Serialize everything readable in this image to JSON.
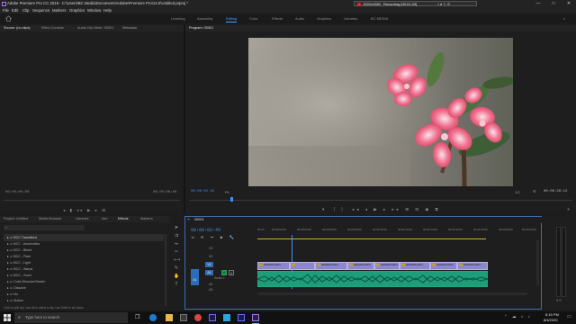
{
  "window": {
    "title": "Adobe Premiere Pro CC 2019 - C:\\Users\\BC Media\\Documents\\Adobe\\Premiere Pro\\13.0\\Untitled.prproj *",
    "minimize": "—",
    "maximize": "□",
    "close": "✕"
  },
  "recorder": {
    "resolution": "1920x1080",
    "status": "Recording [00:01:20]"
  },
  "menu": [
    "File",
    "Edit",
    "Clip",
    "Sequence",
    "Markers",
    "Graphics",
    "Window",
    "Help"
  ],
  "workspaces": [
    {
      "label": "Learning",
      "active": false
    },
    {
      "label": "Assembly",
      "active": false
    },
    {
      "label": "Editing",
      "active": true
    },
    {
      "label": "Color",
      "active": false
    },
    {
      "label": "Effects",
      "active": false
    },
    {
      "label": "Audio",
      "active": false
    },
    {
      "label": "Graphics",
      "active": false
    },
    {
      "label": "Libraries",
      "active": false
    },
    {
      "label": "BC MEDIA",
      "active": false
    }
  ],
  "source_panel": {
    "tabs": [
      "Source: (no clips)",
      "Effect Controls",
      "Audio Clip Mixer: 00001",
      "Metadata"
    ],
    "timecode_left": "00;00;00;00",
    "timecode_right": "00;00;00;00"
  },
  "program_panel": {
    "title": "Program: 00001",
    "timecode": "00:00:02:45",
    "fit": "Fit",
    "quality": "1/2",
    "duration": "00:00:29:12"
  },
  "project_panel": {
    "tabs": [
      "Project: Untitled",
      "Media Browser",
      "Libraries",
      "Info",
      "Effects",
      "Markers"
    ],
    "effects_items": [
      "BCC Transitions",
      "BCC - Assemblies",
      "BCC - Blend",
      "BCC - Flare",
      "BCC - Light",
      "BCC - Warps",
      "BCC - Zoom",
      "Cube Dissolve/Sketch",
      "Dissolve",
      "Iris",
      "Motion"
    ],
    "status": "Click to split clip. Use Alt to select a clip. Use Shift for all tracks."
  },
  "timeline": {
    "tab": "00001",
    "timecode": "00:00:02:45",
    "ruler": [
      "00:00",
      "00:00:02:00",
      "00:00:04:00",
      "00:00:06:00",
      "00:00:08:00",
      "00:00:10:00",
      "00:00:12:00",
      "00:00:14:00",
      "00:00:16:00",
      "00:00:18:00",
      "00:00:20:00",
      "00:00:22:00"
    ],
    "video_tracks": [
      "V3",
      "V2",
      "V1"
    ],
    "audio_tracks": [
      "A1",
      "A2",
      "A3"
    ],
    "source_patch": [
      "V1",
      "A1"
    ],
    "audio_label": "Audio 1",
    "clip_label": "0009400.MP4",
    "playhead_progress": 0.12
  },
  "taskbar": {
    "search_placeholder": "Type here to search",
    "time": "8:15 PM",
    "date": "8/4/2020"
  },
  "colors": {
    "accent": "#3d8eff",
    "clip_video": "#8f86c8",
    "clip_audio": "#1d9e7a",
    "effect_badge": "#c79a2c"
  }
}
